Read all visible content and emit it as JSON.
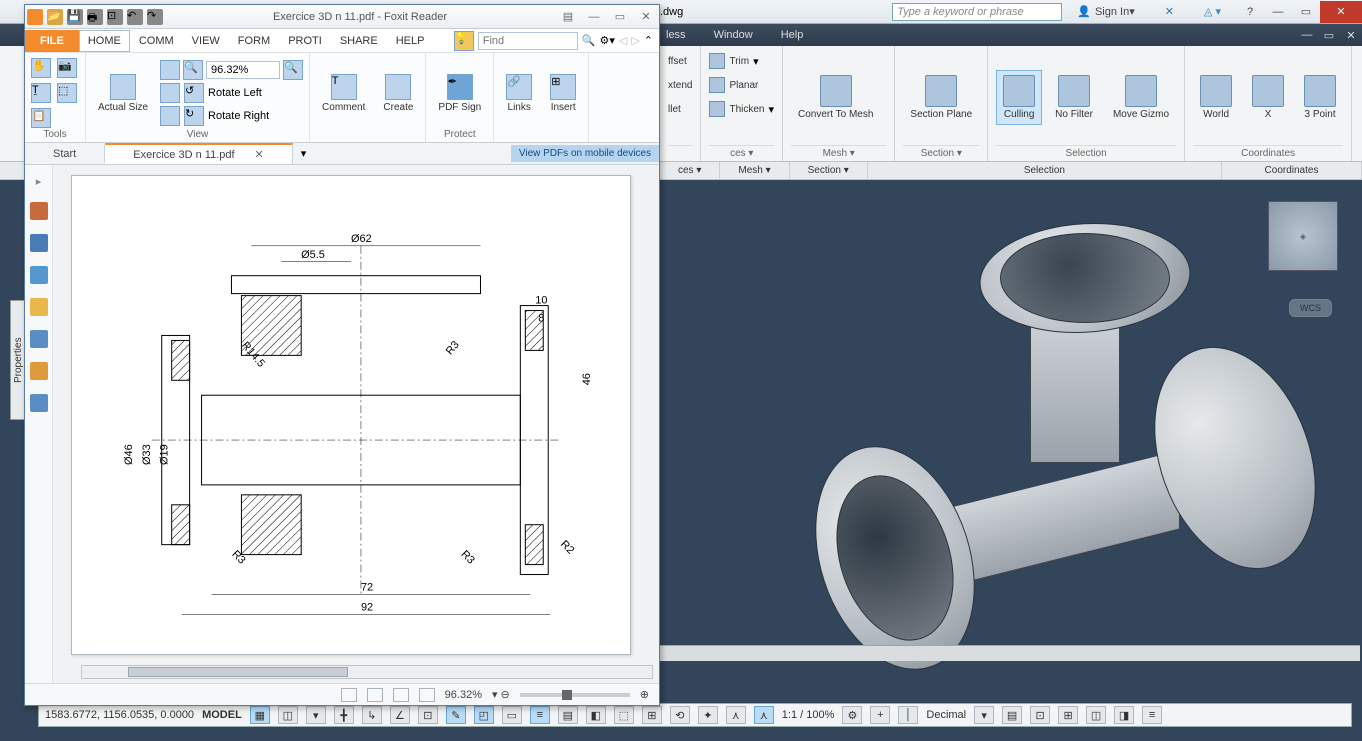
{
  "acad": {
    "filename": ".dwg",
    "search_placeholder": "Type a keyword or phrase",
    "signin": "Sign In",
    "menu": {
      "items": [
        "less",
        "Window",
        "Help"
      ]
    },
    "ribbon": {
      "col1": {
        "labels": [
          "ffset",
          "xtend",
          "llet"
        ],
        "btns": [
          {
            "t": "Trim"
          },
          {
            "t": "Planar"
          },
          {
            "t": "Thicken"
          }
        ]
      },
      "mesh": {
        "label": "Mesh ▾",
        "btn": "Convert\nTo Mesh"
      },
      "section": {
        "label": "Section ▾",
        "btn": "Section\nPlane"
      },
      "selection": {
        "label": "Selection",
        "btns": [
          "Culling",
          "No Filter",
          "Move\nGizmo"
        ]
      },
      "coords": {
        "label": "Coordinates",
        "btns": [
          "World",
          "X",
          "3 Point"
        ]
      },
      "ces_label": "ces ▾"
    },
    "wcs": "WCS",
    "status": {
      "coords": "1583.6772, 1156.0535, 0.0000",
      "model": "MODEL",
      "scale": "1:1 / 100%",
      "units": "Decimal"
    }
  },
  "foxit": {
    "title": "Exercice 3D n 11.pdf - Foxit Reader",
    "menu": {
      "file": "FILE",
      "items": [
        "HOME",
        "COMM",
        "VIEW",
        "FORM",
        "PROTI",
        "SHARE",
        "HELP"
      ]
    },
    "find_placeholder": "Find",
    "zoom": "96.32%",
    "ribbon": {
      "tools_label": "Tools",
      "view_label": "View",
      "actual": "Actual\nSize",
      "rotate_left": "Rotate Left",
      "rotate_right": "Rotate Right",
      "comment": "Comment",
      "create": "Create",
      "pdfsign": "PDF\nSign",
      "protect_label": "Protect",
      "links": "Links",
      "insert": "Insert"
    },
    "tabs": {
      "start": "Start",
      "doc": "Exercice 3D n 11.pdf"
    },
    "mobile": "View PDFs on mobile devices",
    "status_zoom": "96.32%"
  },
  "drawing": {
    "dims": {
      "d62": "Ø62",
      "d55": "Ø5.5",
      "ten": "10",
      "eight": "8",
      "h46": "46",
      "d46": "Ø46",
      "d33": "Ø33",
      "d19": "Ø19",
      "r145": "R14.5",
      "r3a": "R3",
      "b72": "72",
      "b92": "92",
      "r3b": "R3",
      "r3c": "R3",
      "r2": "R2"
    }
  },
  "properties": "Properties"
}
